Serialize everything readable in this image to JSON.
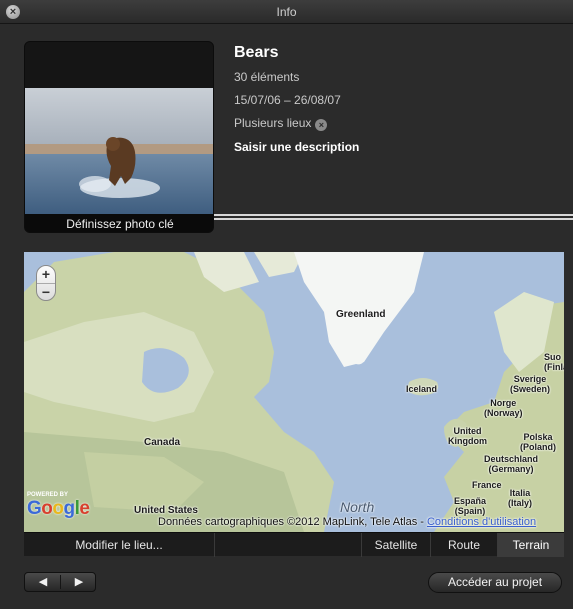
{
  "window": {
    "title": "Info"
  },
  "album": {
    "name": "Bears",
    "count": "30 éléments",
    "dates": "15/07/06 – 26/08/07",
    "places": "Plusieurs lieux",
    "description_prompt": "Saisir une description",
    "key_photo_label": "Définissez photo clé"
  },
  "map": {
    "zoom_in": "+",
    "zoom_out": "−",
    "labels": {
      "greenland": "Greenland",
      "iceland": "Iceland",
      "canada": "Canada",
      "united_states": "United States",
      "north": "North",
      "suo_1": "Suo",
      "suo_2": "(Finla",
      "sverige_1": "Sverige",
      "sverige_2": "(Sweden)",
      "norge_1": "Norge",
      "norge_2": "(Norway)",
      "uk_1": "United",
      "uk_2": "Kingdom",
      "polska_1": "Polska",
      "polska_2": "(Poland)",
      "de_1": "Deutschland",
      "de_2": "(Germany)",
      "france": "France",
      "italia_1": "Italia",
      "italia_2": "(Italy)",
      "espana_1": "España",
      "espana_2": "(Spain)"
    },
    "powered_by": "POWERED BY",
    "attribution": "Données cartographiques ©2012 MapLink, Tele Atlas -",
    "terms_link": "Conditions d'utilisation"
  },
  "map_toolbar": {
    "edit_location": "Modifier le lieu...",
    "satellite": "Satellite",
    "road": "Route",
    "terrain": "Terrain",
    "active": "Terrain"
  },
  "footer": {
    "prev": "◀",
    "next": "▶",
    "go_to_project": "Accéder au projet"
  }
}
